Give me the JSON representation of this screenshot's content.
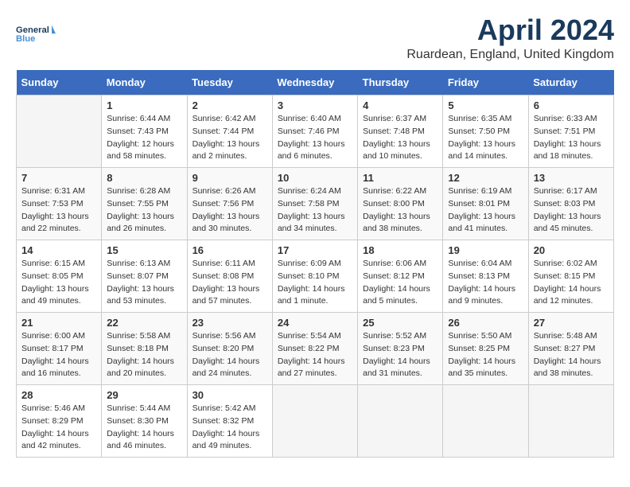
{
  "header": {
    "logo_line1": "General",
    "logo_line2": "Blue",
    "month": "April 2024",
    "location": "Ruardean, England, United Kingdom"
  },
  "days_of_week": [
    "Sunday",
    "Monday",
    "Tuesday",
    "Wednesday",
    "Thursday",
    "Friday",
    "Saturday"
  ],
  "weeks": [
    [
      {
        "day": "",
        "empty": true
      },
      {
        "day": "1",
        "sunrise": "Sunrise: 6:44 AM",
        "sunset": "Sunset: 7:43 PM",
        "daylight": "Daylight: 12 hours and 58 minutes."
      },
      {
        "day": "2",
        "sunrise": "Sunrise: 6:42 AM",
        "sunset": "Sunset: 7:44 PM",
        "daylight": "Daylight: 13 hours and 2 minutes."
      },
      {
        "day": "3",
        "sunrise": "Sunrise: 6:40 AM",
        "sunset": "Sunset: 7:46 PM",
        "daylight": "Daylight: 13 hours and 6 minutes."
      },
      {
        "day": "4",
        "sunrise": "Sunrise: 6:37 AM",
        "sunset": "Sunset: 7:48 PM",
        "daylight": "Daylight: 13 hours and 10 minutes."
      },
      {
        "day": "5",
        "sunrise": "Sunrise: 6:35 AM",
        "sunset": "Sunset: 7:50 PM",
        "daylight": "Daylight: 13 hours and 14 minutes."
      },
      {
        "day": "6",
        "sunrise": "Sunrise: 6:33 AM",
        "sunset": "Sunset: 7:51 PM",
        "daylight": "Daylight: 13 hours and 18 minutes."
      }
    ],
    [
      {
        "day": "7",
        "sunrise": "Sunrise: 6:31 AM",
        "sunset": "Sunset: 7:53 PM",
        "daylight": "Daylight: 13 hours and 22 minutes."
      },
      {
        "day": "8",
        "sunrise": "Sunrise: 6:28 AM",
        "sunset": "Sunset: 7:55 PM",
        "daylight": "Daylight: 13 hours and 26 minutes."
      },
      {
        "day": "9",
        "sunrise": "Sunrise: 6:26 AM",
        "sunset": "Sunset: 7:56 PM",
        "daylight": "Daylight: 13 hours and 30 minutes."
      },
      {
        "day": "10",
        "sunrise": "Sunrise: 6:24 AM",
        "sunset": "Sunset: 7:58 PM",
        "daylight": "Daylight: 13 hours and 34 minutes."
      },
      {
        "day": "11",
        "sunrise": "Sunrise: 6:22 AM",
        "sunset": "Sunset: 8:00 PM",
        "daylight": "Daylight: 13 hours and 38 minutes."
      },
      {
        "day": "12",
        "sunrise": "Sunrise: 6:19 AM",
        "sunset": "Sunset: 8:01 PM",
        "daylight": "Daylight: 13 hours and 41 minutes."
      },
      {
        "day": "13",
        "sunrise": "Sunrise: 6:17 AM",
        "sunset": "Sunset: 8:03 PM",
        "daylight": "Daylight: 13 hours and 45 minutes."
      }
    ],
    [
      {
        "day": "14",
        "sunrise": "Sunrise: 6:15 AM",
        "sunset": "Sunset: 8:05 PM",
        "daylight": "Daylight: 13 hours and 49 minutes."
      },
      {
        "day": "15",
        "sunrise": "Sunrise: 6:13 AM",
        "sunset": "Sunset: 8:07 PM",
        "daylight": "Daylight: 13 hours and 53 minutes."
      },
      {
        "day": "16",
        "sunrise": "Sunrise: 6:11 AM",
        "sunset": "Sunset: 8:08 PM",
        "daylight": "Daylight: 13 hours and 57 minutes."
      },
      {
        "day": "17",
        "sunrise": "Sunrise: 6:09 AM",
        "sunset": "Sunset: 8:10 PM",
        "daylight": "Daylight: 14 hours and 1 minute."
      },
      {
        "day": "18",
        "sunrise": "Sunrise: 6:06 AM",
        "sunset": "Sunset: 8:12 PM",
        "daylight": "Daylight: 14 hours and 5 minutes."
      },
      {
        "day": "19",
        "sunrise": "Sunrise: 6:04 AM",
        "sunset": "Sunset: 8:13 PM",
        "daylight": "Daylight: 14 hours and 9 minutes."
      },
      {
        "day": "20",
        "sunrise": "Sunrise: 6:02 AM",
        "sunset": "Sunset: 8:15 PM",
        "daylight": "Daylight: 14 hours and 12 minutes."
      }
    ],
    [
      {
        "day": "21",
        "sunrise": "Sunrise: 6:00 AM",
        "sunset": "Sunset: 8:17 PM",
        "daylight": "Daylight: 14 hours and 16 minutes."
      },
      {
        "day": "22",
        "sunrise": "Sunrise: 5:58 AM",
        "sunset": "Sunset: 8:18 PM",
        "daylight": "Daylight: 14 hours and 20 minutes."
      },
      {
        "day": "23",
        "sunrise": "Sunrise: 5:56 AM",
        "sunset": "Sunset: 8:20 PM",
        "daylight": "Daylight: 14 hours and 24 minutes."
      },
      {
        "day": "24",
        "sunrise": "Sunrise: 5:54 AM",
        "sunset": "Sunset: 8:22 PM",
        "daylight": "Daylight: 14 hours and 27 minutes."
      },
      {
        "day": "25",
        "sunrise": "Sunrise: 5:52 AM",
        "sunset": "Sunset: 8:23 PM",
        "daylight": "Daylight: 14 hours and 31 minutes."
      },
      {
        "day": "26",
        "sunrise": "Sunrise: 5:50 AM",
        "sunset": "Sunset: 8:25 PM",
        "daylight": "Daylight: 14 hours and 35 minutes."
      },
      {
        "day": "27",
        "sunrise": "Sunrise: 5:48 AM",
        "sunset": "Sunset: 8:27 PM",
        "daylight": "Daylight: 14 hours and 38 minutes."
      }
    ],
    [
      {
        "day": "28",
        "sunrise": "Sunrise: 5:46 AM",
        "sunset": "Sunset: 8:29 PM",
        "daylight": "Daylight: 14 hours and 42 minutes."
      },
      {
        "day": "29",
        "sunrise": "Sunrise: 5:44 AM",
        "sunset": "Sunset: 8:30 PM",
        "daylight": "Daylight: 14 hours and 46 minutes."
      },
      {
        "day": "30",
        "sunrise": "Sunrise: 5:42 AM",
        "sunset": "Sunset: 8:32 PM",
        "daylight": "Daylight: 14 hours and 49 minutes."
      },
      {
        "day": "",
        "empty": true
      },
      {
        "day": "",
        "empty": true
      },
      {
        "day": "",
        "empty": true
      },
      {
        "day": "",
        "empty": true
      }
    ]
  ]
}
